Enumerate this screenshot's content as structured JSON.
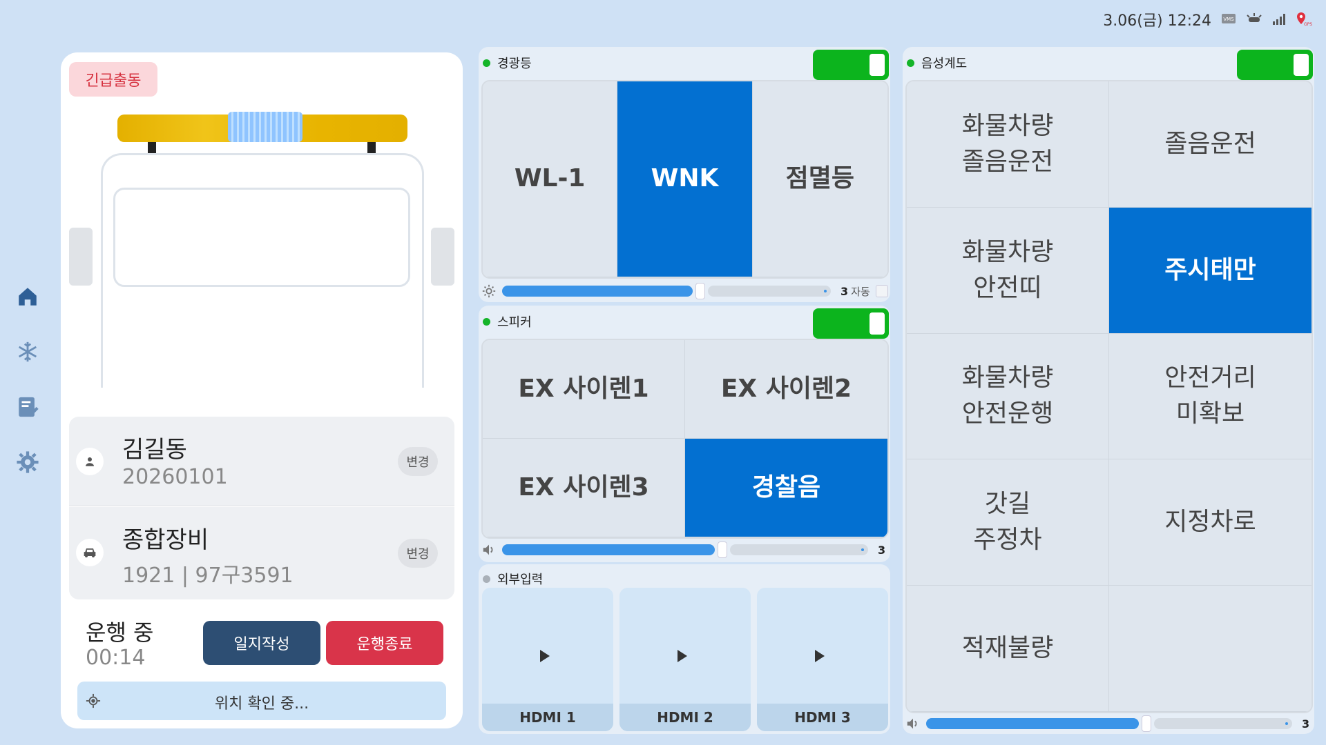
{
  "status_bar": {
    "datetime": "3.06(금) 12:24",
    "icons": [
      "vms-icon",
      "sun-brightness-icon",
      "signal-icon",
      "gps-icon"
    ]
  },
  "nav": {
    "items": [
      {
        "name": "home",
        "icon": "home-icon",
        "active": true
      },
      {
        "name": "climate",
        "icon": "snowflake-icon",
        "active": false
      },
      {
        "name": "log",
        "icon": "checklist-icon",
        "active": false
      },
      {
        "name": "settings",
        "icon": "gear-icon",
        "active": false
      }
    ]
  },
  "vehicle_card": {
    "emergency_badge": "긴급출동",
    "driver": {
      "name": "김길동",
      "id": "20260101",
      "change_label": "변경"
    },
    "vehicle": {
      "name": "종합장비",
      "plate": "1921 | 97구3591",
      "change_label": "변경"
    },
    "trip": {
      "status": "운행 중",
      "elapsed": "00:14",
      "log_button": "일지작성",
      "end_button": "운행종료"
    },
    "location": "위치 확인 중..."
  },
  "warning_light": {
    "title": "경광등",
    "enabled": true,
    "options": [
      "WL-1",
      "WNK",
      "점멸등"
    ],
    "selected": "WNK",
    "brightness_level": "3",
    "brightness_fraction": 0.6,
    "auto_label": "자동"
  },
  "speaker": {
    "title": "스피커",
    "enabled": true,
    "options": [
      "EX 사이렌1",
      "EX 사이렌2",
      "EX 사이렌3",
      "경찰음"
    ],
    "selected": "경찰음",
    "volume_level": "3",
    "volume_fraction": 0.6
  },
  "external_input": {
    "title": "외부입력",
    "enabled": false,
    "inputs": [
      "HDMI 1",
      "HDMI 2",
      "HDMI 3"
    ]
  },
  "voice_guidance": {
    "title": "음성계도",
    "enabled": true,
    "options": [
      "화물차량\n졸음운전",
      "졸음운전",
      "화물차량\n안전띠",
      "주시태만",
      "화물차량\n안전운행",
      "안전거리\n미확보",
      "갓길\n주정차",
      "지정차로",
      "적재불량",
      ""
    ],
    "selected": "주시태만",
    "volume_level": "3",
    "volume_fraction": 0.6
  },
  "colors": {
    "selected": "#0370d1",
    "toggle_on": "#0cb41d",
    "emergency": "#d6303e",
    "end_button": "#d9344a",
    "log_button": "#2d4e73"
  }
}
